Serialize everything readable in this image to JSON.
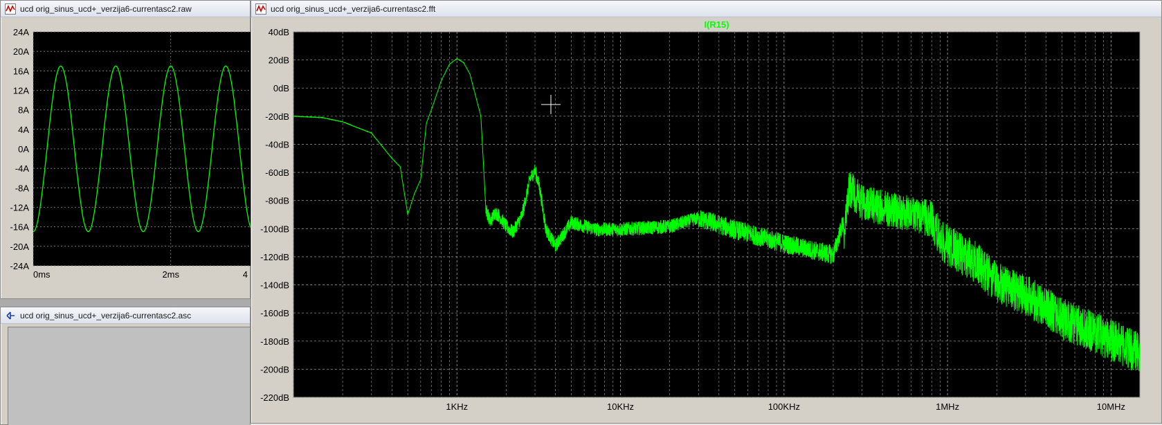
{
  "windows": {
    "raw": {
      "title": "ucd orig_sinus_ucd+_verzija6-currentasc2.raw",
      "y_ticks": [
        "24A",
        "20A",
        "16A",
        "12A",
        "8A",
        "4A",
        "0A",
        "-4A",
        "-8A",
        "-12A",
        "-16A",
        "-20A",
        "-24A"
      ],
      "x_ticks": [
        "0ms",
        "2ms",
        "4"
      ],
      "trace_color": "#00ff00",
      "waveform": {
        "amplitude_A": 17,
        "period_ms": 0.8,
        "y_range": [
          -24,
          24
        ],
        "x_range_ms": [
          0,
          4.0
        ]
      }
    },
    "asc": {
      "title": "ucd orig_sinus_ucd+_verzija6-currentasc2.asc"
    },
    "fft": {
      "title": "ucd orig_sinus_ucd+_verzija6-currentasc2.fft",
      "trace_name": "I(R15)",
      "y_ticks": [
        "40dB",
        "20dB",
        "0dB",
        "-20dB",
        "-40dB",
        "-60dB",
        "-80dB",
        "-100dB",
        "-120dB",
        "-140dB",
        "-160dB",
        "-180dB",
        "-200dB",
        "-220dB"
      ],
      "x_ticks": [
        "1KHz",
        "10KHz",
        "100KHz",
        "1MHz",
        "10MHz"
      ],
      "trace_color": "#00ff00",
      "background": "#000000",
      "grid_color": "#8a8a8a"
    }
  },
  "chart_data": [
    {
      "type": "line",
      "series": [
        {
          "name": "",
          "x": [
            0,
            0.2,
            0.4,
            0.6,
            0.8
          ],
          "y": [
            -17,
            0,
            17,
            0,
            -17
          ]
        }
      ],
      "xlabel": "",
      "ylabel": "",
      "xlim": [
        0,
        4.0
      ],
      "ylim": [
        -24,
        24
      ],
      "grid": true
    },
    {
      "type": "line",
      "scale_x": "log",
      "series": [
        {
          "name": "I(R15)",
          "x": [
            100,
            150,
            200,
            300,
            400,
            450,
            500,
            550,
            600,
            650,
            700,
            800,
            900,
            1000,
            1100,
            1200,
            1400,
            1500,
            1600,
            1700,
            1800,
            2000,
            2200,
            2500,
            2800,
            3000,
            3200,
            3500,
            4000,
            5000,
            7000,
            10000,
            20000,
            30000,
            50000,
            100000,
            200000,
            230000,
            250000,
            300000,
            500000,
            800000,
            900000,
            1500000,
            2000000,
            3000000,
            5000000,
            10000000,
            15000000
          ],
          "y": [
            -20,
            -21,
            -24,
            -32,
            -50,
            -56,
            -90,
            -75,
            -65,
            -25,
            -15,
            5,
            17,
            21,
            18,
            10,
            -20,
            -85,
            -95,
            -88,
            -90,
            -98,
            -102,
            -90,
            -64,
            -58,
            -70,
            -100,
            -112,
            -95,
            -100,
            -100,
            -98,
            -92,
            -100,
            -110,
            -118,
            -95,
            -58,
            -68,
            -75,
            -80,
            -100,
            -115,
            -130,
            -138,
            -155,
            -170,
            -180
          ]
        }
      ],
      "xlabel": "",
      "ylabel": "",
      "xlim": [
        100,
        15000000
      ],
      "ylim": [
        -220,
        40
      ],
      "grid": true
    }
  ]
}
